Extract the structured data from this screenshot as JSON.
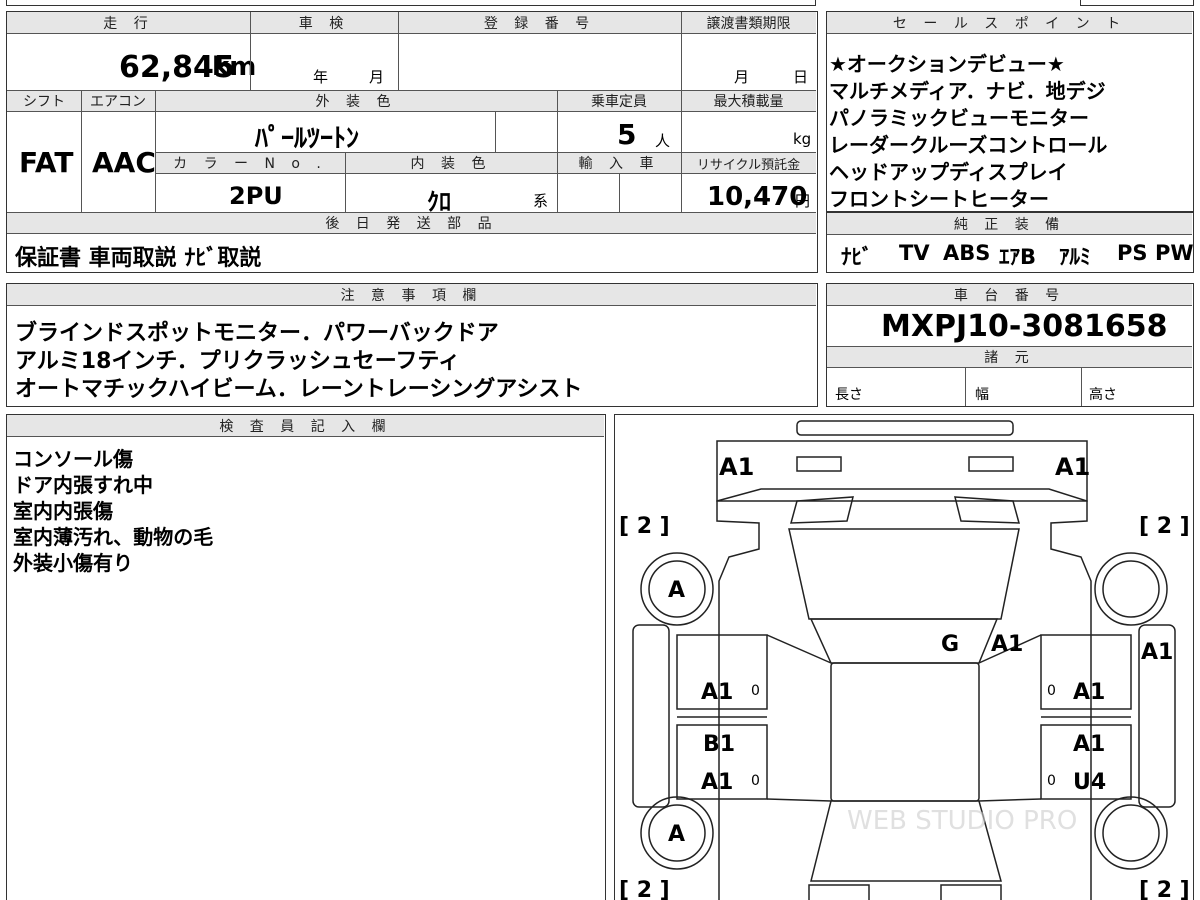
{
  "top_table": {
    "headers": {
      "mileage": "走 行",
      "inspection": "車 検",
      "registration_number": "登 録 番 号",
      "transfer_deadline": "譲渡書類期限",
      "shift": "シフト",
      "aircon": "エアコン",
      "exterior_color": "外 装 色",
      "capacity": "乗車定員",
      "max_load": "最大積載量",
      "color_no": "カ ラ ー N o .",
      "interior_color": "内 装 色",
      "import_car": "輸 入 車",
      "recycle_deposit": "リサイクル預託金",
      "later_parts": "後 日 発 送 部 品"
    },
    "mileage_value": "62,845",
    "mileage_unit": "km",
    "inspection_year": "年",
    "inspection_month": "月",
    "deadline_month": "月",
    "deadline_day": "日",
    "shift_value": "FAT",
    "aircon_value": "AAC",
    "exterior_color_value": "ﾊﾟｰﾙﾂｰﾄﾝ",
    "capacity_value": "5",
    "capacity_unit": "人",
    "max_load_unit": "kg",
    "color_no_value": "2PU",
    "interior_color_value": "ｸﾛ",
    "interior_color_suffix": "系",
    "recycle_value": "10,470",
    "recycle_unit": "円",
    "later_parts_value": "保証書 車両取説 ﾅﾋﾞ取説"
  },
  "sales_points": {
    "header": "セ ー ル ス ポ イ ン ト",
    "items": [
      "★オークションデビュー★",
      "マルチメディア．ナビ．地デジ",
      "パノラミックビューモニター",
      "レーダークルーズコントロール",
      "ヘッドアップディスプレイ",
      "フロントシートヒーター"
    ]
  },
  "genuine_equipment": {
    "header": "純 正 装 備",
    "items": [
      "ﾅﾋﾞ",
      "TV",
      "ABS",
      "ｴｱB",
      "ｱﾙﾐ",
      "PS",
      "PW"
    ]
  },
  "notes": {
    "header": "注 意 事 項 欄",
    "lines": [
      "ブラインドスポットモニター．パワーバックドア",
      "アルミ18インチ．プリクラッシュセーフティ",
      "オートマチックハイビーム．レーントレーシングアシスト"
    ]
  },
  "chassis": {
    "header": "車 台 番 号",
    "value": "MXPJ10-3081658"
  },
  "specs": {
    "header": "諸 元",
    "length": "長さ",
    "width": "幅",
    "height": "高さ"
  },
  "inspector": {
    "header": "検 査 員 記 入 欄",
    "lines": [
      "コンソール傷",
      "ドア内張すれ中",
      "室内内張傷",
      "室内薄汚れ、動物の毛",
      "外装小傷有り"
    ]
  },
  "diagram": {
    "marks": {
      "front_left": "A1",
      "front_right": "A1",
      "bracket_tl": "[ 2 ]",
      "bracket_tr": "[ 2 ]",
      "bracket_bl": "[ 2 ]",
      "bracket_br": "[ 2 ]",
      "wheel_fl": "A",
      "wheel_rl": "A",
      "windshield_g": "G",
      "windshield_a1": "A1",
      "right_fender": "A1",
      "left_front_door": "A1",
      "left_rear_door_top": "B1",
      "left_rear_door_bottom": "A1",
      "right_front_door": "A1",
      "right_rear_door_top": "A1",
      "right_rear_door_bottom": "U4",
      "zero_1": "0",
      "zero_2": "0",
      "zero_3": "0",
      "zero_4": "0"
    },
    "watermark": "WEB STUDIO PRO"
  }
}
